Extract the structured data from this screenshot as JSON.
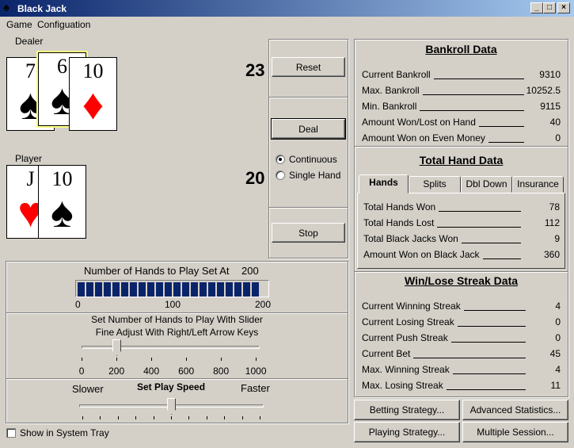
{
  "window": {
    "title": "Black Jack"
  },
  "menu": {
    "game": "Game",
    "config": "Configuation"
  },
  "dealer": {
    "label": "Dealer",
    "total": "23",
    "cards": [
      {
        "rank": "7",
        "suit": "♠",
        "color": "#000000"
      },
      {
        "rank": "6",
        "suit": "♠",
        "color": "#000000"
      },
      {
        "rank": "10",
        "suit": "♦",
        "color": "#ff0000"
      }
    ]
  },
  "player": {
    "label": "Player",
    "total": "20",
    "cards": [
      {
        "rank": "J",
        "suit": "♥",
        "color": "#ff0000"
      },
      {
        "rank": "10",
        "suit": "♠",
        "color": "#000000"
      }
    ]
  },
  "controls": {
    "reset": "Reset",
    "deal": "Deal",
    "stop": "Stop",
    "mode_continuous": "Continuous",
    "mode_single": "Single Hand",
    "selected_mode": "Continuous"
  },
  "hands_panel": {
    "title": "Number of Hands to Play Set At",
    "value": "200",
    "progress_fraction": 1.0,
    "progress_min": "0",
    "progress_mid": "100",
    "progress_max": "200",
    "slider_line1": "Set Number of Hands to Play With Slider",
    "slider_line2": "Fine Adjust With Right/Left Arrow Keys",
    "slider_value": 200,
    "slider_ticks": [
      "0",
      "200",
      "400",
      "600",
      "800",
      "1000"
    ]
  },
  "speed": {
    "slower": "Slower",
    "title": "Set Play Speed",
    "faster": "Faster",
    "level": 0.5
  },
  "tray": {
    "label": "Show in System Tray",
    "checked": false
  },
  "bankroll": {
    "title": "Bankroll Data",
    "rows": [
      {
        "label": "Current Bankroll",
        "value": "9310"
      },
      {
        "label": "Max. Bankroll",
        "value": "10252.5"
      },
      {
        "label": "Min. Bankroll",
        "value": "9115"
      },
      {
        "label": "Amount Won/Lost on Hand",
        "value": "40"
      },
      {
        "label": "Amount Won on Even Money",
        "value": "0"
      }
    ]
  },
  "hand_data": {
    "title": "Total Hand Data",
    "tabs": [
      "Hands",
      "Splits",
      "Dbl Down",
      "Insurance"
    ],
    "active_tab": "Hands",
    "rows": [
      {
        "label": "Total Hands Won",
        "value": "78"
      },
      {
        "label": "Total Hands Lost",
        "value": "112"
      },
      {
        "label": "Total Black Jacks Won",
        "value": "9"
      },
      {
        "label": "Amount Won on Black Jack",
        "value": "360"
      }
    ]
  },
  "streak": {
    "title": "Win/Lose Streak Data",
    "rows": [
      {
        "label": "Current Winning Streak",
        "value": "4"
      },
      {
        "label": "Current Losing Streak",
        "value": "0"
      },
      {
        "label": "Current Push Streak",
        "value": "0"
      },
      {
        "label": "Current Bet",
        "value": "45"
      },
      {
        "label": "Max. Winning Streak",
        "value": "4"
      },
      {
        "label": "Max. Losing Streak",
        "value": "11"
      }
    ]
  },
  "bottom_buttons": {
    "betting": "Betting Strategy...",
    "advanced": "Advanced Statistics...",
    "playing": "Playing Strategy...",
    "multiple": "Multiple Session..."
  }
}
